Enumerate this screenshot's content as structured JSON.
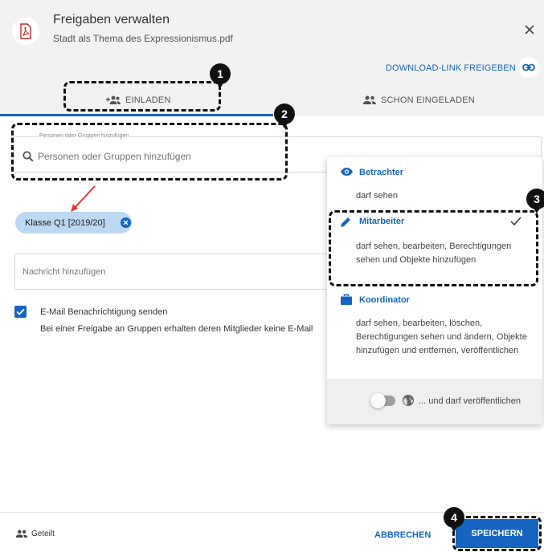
{
  "dialog": {
    "title": "Freigaben verwalten",
    "filename": "Stadt als Thema des Expressionismus.pdf",
    "download_link": "DOWNLOAD-LINK FREIGEBEN"
  },
  "tabs": [
    {
      "label": "EINLADEN",
      "active": true
    },
    {
      "label": "SCHON EINGELADEN",
      "active": false
    }
  ],
  "search": {
    "legend": "Personen oder Gruppen hinzufügen",
    "placeholder": "Personen oder Gruppen hinzufügen"
  },
  "chip": {
    "label": "Klasse Q1 [2019/20]"
  },
  "message": {
    "placeholder": "Nachricht hinzufügen"
  },
  "email": {
    "checked": true,
    "label": "E-Mail Benachrichtigung senden",
    "hint": "Bei einer Freigabe an Gruppen erhalten deren Mitglieder keine E-Mail"
  },
  "roles": [
    {
      "name": "Betrachter",
      "icon": "eye-icon",
      "desc": "darf sehen",
      "selected": false
    },
    {
      "name": "Mitarbeiter",
      "icon": "pencil-icon",
      "desc": "darf sehen, bearbeiten, Berechtigungen sehen und Objekte hinzufügen",
      "selected": true
    },
    {
      "name": "Koordinator",
      "icon": "briefcase-icon",
      "desc": "darf sehen, bearbeiten, löschen, Berechtigungen sehen und ändern, Objekte hinzufügen und entfernen, veröffentlichen",
      "selected": false
    }
  ],
  "publish": {
    "label": "... und darf veröffentlichen",
    "enabled": false
  },
  "footer": {
    "shared_label": "Geteilt",
    "cancel": "ABBRECHEN",
    "save": "SPEICHERN"
  },
  "annotations": [
    "1",
    "2",
    "3",
    "4"
  ],
  "colors": {
    "accent": "#1565c0",
    "chip": "#bcd8f3",
    "annotation": "#111111",
    "arrow": "#e53935"
  }
}
